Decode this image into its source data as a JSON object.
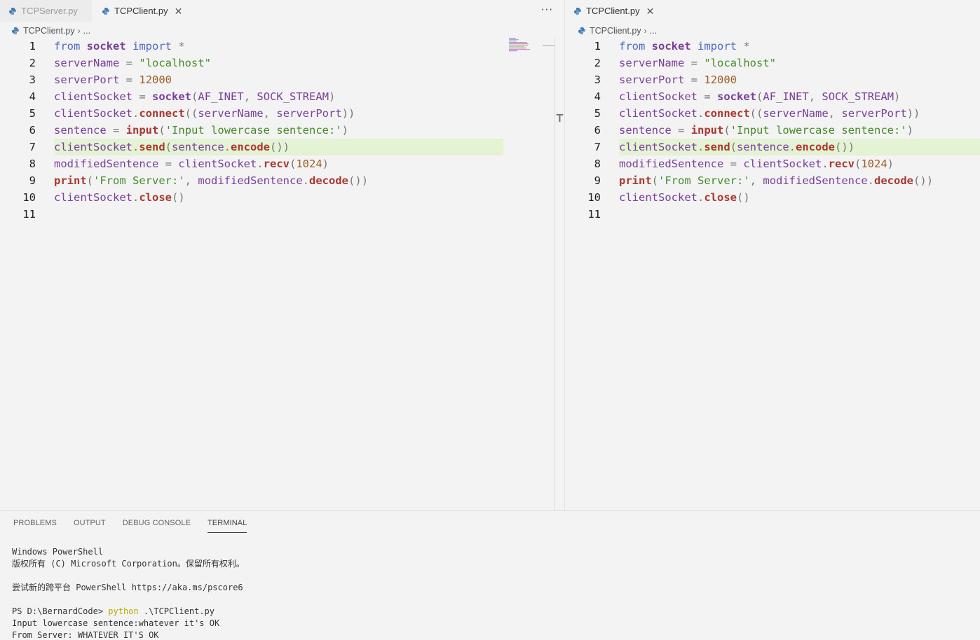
{
  "editor_groups": [
    {
      "tabs": [
        {
          "label": "TCPServer.py",
          "active": false
        },
        {
          "label": "TCPClient.py",
          "active": true
        }
      ],
      "more_actions_label": "···",
      "breadcrumb": {
        "file": "TCPClient.py",
        "rest": "..."
      }
    },
    {
      "tabs": [
        {
          "label": "TCPClient.py",
          "active": true
        }
      ],
      "breadcrumb": {
        "file": "TCPClient.py",
        "rest": "..."
      }
    }
  ],
  "code": {
    "highlighted_line": 7,
    "lines": [
      "from socket import *",
      "serverName = \"localhost\"",
      "serverPort = 12000",
      "clientSocket = socket(AF_INET, SOCK_STREAM)",
      "clientSocket.connect((serverName, serverPort))",
      "sentence = input('Input lowercase sentence:')",
      "clientSocket.send(sentence.encode())",
      "modifiedSentence = clientSocket.recv(1024)",
      "print('From Server:', modifiedSentence.decode())",
      "clientSocket.close()",
      ""
    ]
  },
  "panel": {
    "tabs": [
      "PROBLEMS",
      "OUTPUT",
      "DEBUG CONSOLE",
      "TERMINAL"
    ],
    "active_tab": "TERMINAL",
    "terminal": {
      "line1": "Windows PowerShell",
      "line2": "版权所有 (C) Microsoft Corporation。保留所有权利。",
      "line3": "",
      "line4": "尝试新的跨平台 PowerShell https://aka.ms/pscore6",
      "line5": "",
      "prompt": "PS D:\\BernardCode> ",
      "command": "python",
      "args": " .\\TCPClient.py",
      "line7": "Input lowercase sentence:whatever it's OK",
      "line8": "From Server: WHATEVER IT'S OK"
    }
  },
  "colors": {
    "background": "#f3f3f3",
    "line_highlight": "#e5f3d5",
    "keyword": "#4b69c6",
    "function": "#aa3731",
    "string": "#448c27",
    "number": "#9c5d27",
    "variable": "#7a3e9d"
  }
}
